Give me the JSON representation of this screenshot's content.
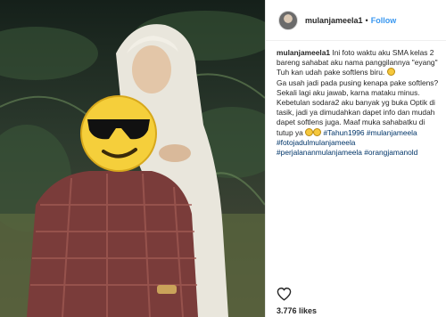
{
  "post": {
    "username": "mulanjameela1",
    "follow_label": "Follow",
    "dot": "•",
    "caption": {
      "username": "mulanjameela1",
      "line1": " Ini foto waktu aku SMA kelas 2 bareng sahabat aku nama panggilannya \"eyang\"",
      "line2": "Tuh kan udah pake softlens biru. ",
      "line3": "Ga usah jadi pada pusing kenapa pake softlens? Sekali lagi aku jawab, karna mataku minus. Kebetulan sodara2 aku banyak yg buka Optik di tasik, jadi ya dimudahkan dapet info dan mudah dapet softlens juga. Maaf muka sahabatku di tutup ya ",
      "hashtags": [
        "#Tahun1996",
        "#mulanjameela",
        "#fotojadulmulanjameela",
        "#perjalananmulanjameela",
        "#orangjamanold"
      ]
    },
    "likes": "3.776 likes"
  },
  "icons": {
    "like": "heart-outline-icon",
    "face_cover": "sunglasses-emoji-icon"
  },
  "colors": {
    "follow": "#3897f0",
    "hashtag": "#003569",
    "emoji": "#f6c83c"
  }
}
